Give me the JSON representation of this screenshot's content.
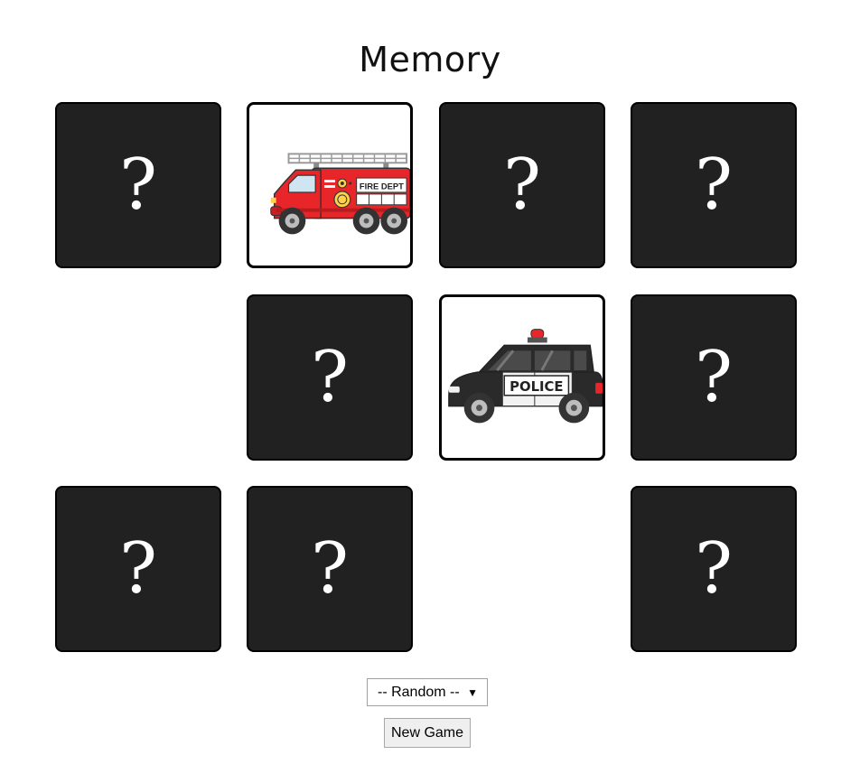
{
  "game": {
    "title": "Memory",
    "hidden_symbol": "?",
    "cards": [
      {
        "state": "hidden"
      },
      {
        "state": "face-up",
        "image": "fire-truck",
        "label": "FIRE DEPT"
      },
      {
        "state": "hidden"
      },
      {
        "state": "hidden"
      },
      {
        "state": "matched"
      },
      {
        "state": "hidden"
      },
      {
        "state": "face-up",
        "image": "police-car",
        "label": "POLICE"
      },
      {
        "state": "hidden"
      },
      {
        "state": "hidden"
      },
      {
        "state": "hidden"
      },
      {
        "state": "matched"
      },
      {
        "state": "hidden"
      }
    ]
  },
  "controls": {
    "theme_select": {
      "selected": "-- Random --",
      "arrow": "▼"
    },
    "new_game_label": "New Game"
  },
  "colors": {
    "card_back": "#212121",
    "card_border": "#000000",
    "question_mark": "#ffffff",
    "fire_truck_red": "#e8262a",
    "police_black": "#2a2a2a"
  }
}
